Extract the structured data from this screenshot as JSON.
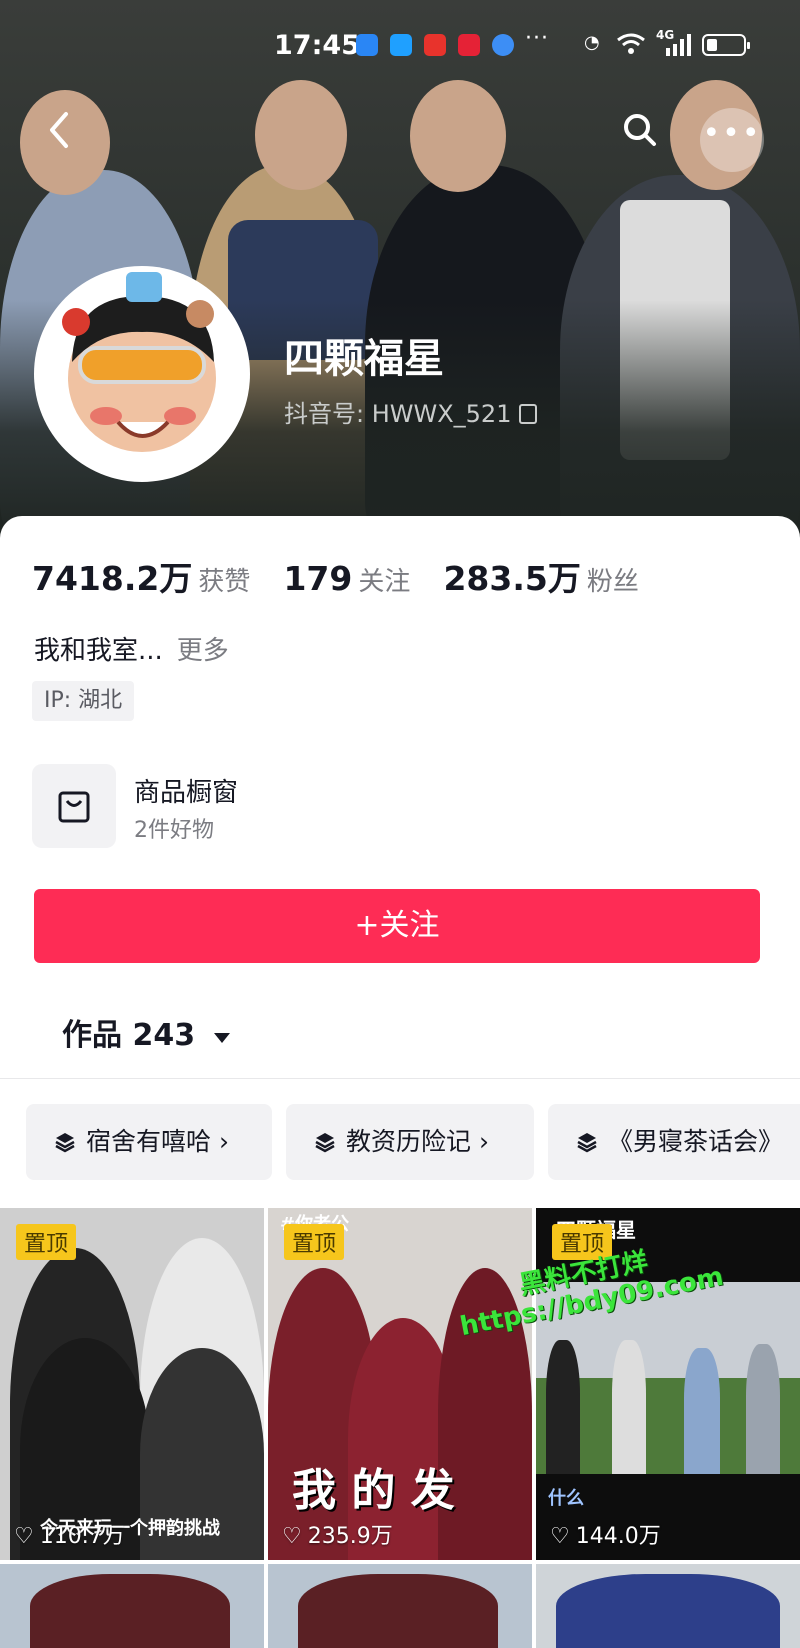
{
  "status_bar": {
    "time": "17:45",
    "network": "4G"
  },
  "profile": {
    "nickname": "四颗福星",
    "douyin_id": "抖音号: HWWX_521",
    "likes_count": "7418.2万",
    "likes_label": "获赞",
    "following_count": "179",
    "following_label": "关注",
    "followers_count": "283.5万",
    "followers_label": "粉丝",
    "bio": "我和我室...",
    "bio_more": "更多",
    "ip": "IP: 湖北"
  },
  "shop": {
    "title": "商品橱窗",
    "subtitle": "2件好物"
  },
  "follow_button": "+关注",
  "works_tab": "作品 243",
  "collections": [
    {
      "label": "宿舍有嘻哈 ›"
    },
    {
      "label": "教资历险记 ›"
    },
    {
      "label": "《男寝茶话会》"
    }
  ],
  "videos": [
    {
      "pinned": "置顶",
      "likes": "110.7万",
      "caption": "今天来玩一个押韵挑战"
    },
    {
      "pinned": "置顶",
      "likes": "235.9万",
      "caption": "我 的 发",
      "top_text": "#你老公"
    },
    {
      "pinned": "置顶",
      "likes": "144.0万",
      "top_text": "四颗福星",
      "caption": "什么"
    }
  ],
  "watermark": {
    "line1": "黑料不打烊",
    "line2": "https://bdy09.com"
  },
  "colors": {
    "accent": "#fe2c55",
    "pin": "#f6c61c",
    "watermark": "#3be53b"
  }
}
